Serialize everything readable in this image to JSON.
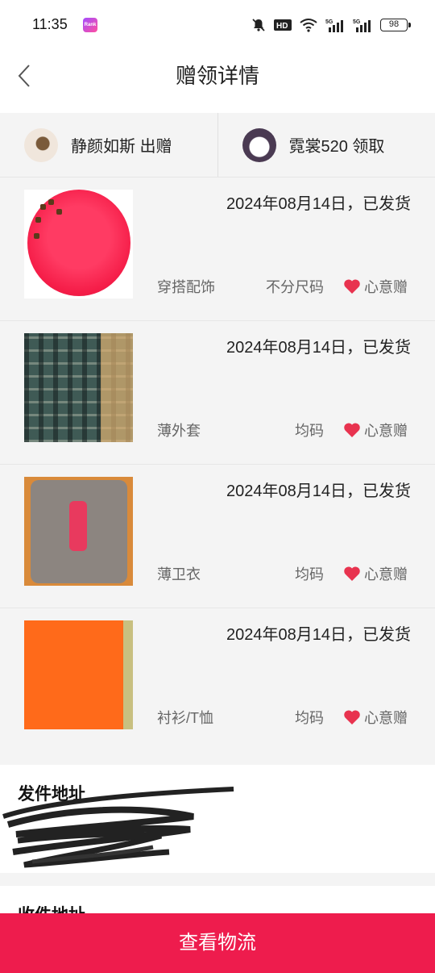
{
  "status_bar": {
    "time": "11:35",
    "app_badge": "Rank",
    "battery": "98"
  },
  "header": {
    "title": "赠领详情",
    "back_icon": "chevron-left-icon"
  },
  "people": {
    "giver_label": "静颜如斯 出赠",
    "receiver_label": "霓裳520 领取"
  },
  "items": [
    {
      "date_status": "2024年08月14日，已发货",
      "category": "穿搭配饰",
      "size": "不分尺码",
      "type": "心意赠"
    },
    {
      "date_status": "2024年08月14日，已发货",
      "category": "薄外套",
      "size": "均码",
      "type": "心意赠"
    },
    {
      "date_status": "2024年08月14日，已发货",
      "category": "薄卫衣",
      "size": "均码",
      "type": "心意赠"
    },
    {
      "date_status": "2024年08月14日，已发货",
      "category": "衬衫/T恤",
      "size": "均码",
      "type": "心意赠"
    }
  ],
  "sender_address": {
    "title": "发件地址"
  },
  "receiver_address": {
    "title": "收件地址"
  },
  "bottom_button": {
    "label": "查看物流"
  },
  "colors": {
    "accent": "#ee1c4d",
    "heart": "#e8334f",
    "background": "#f4f4f4"
  }
}
